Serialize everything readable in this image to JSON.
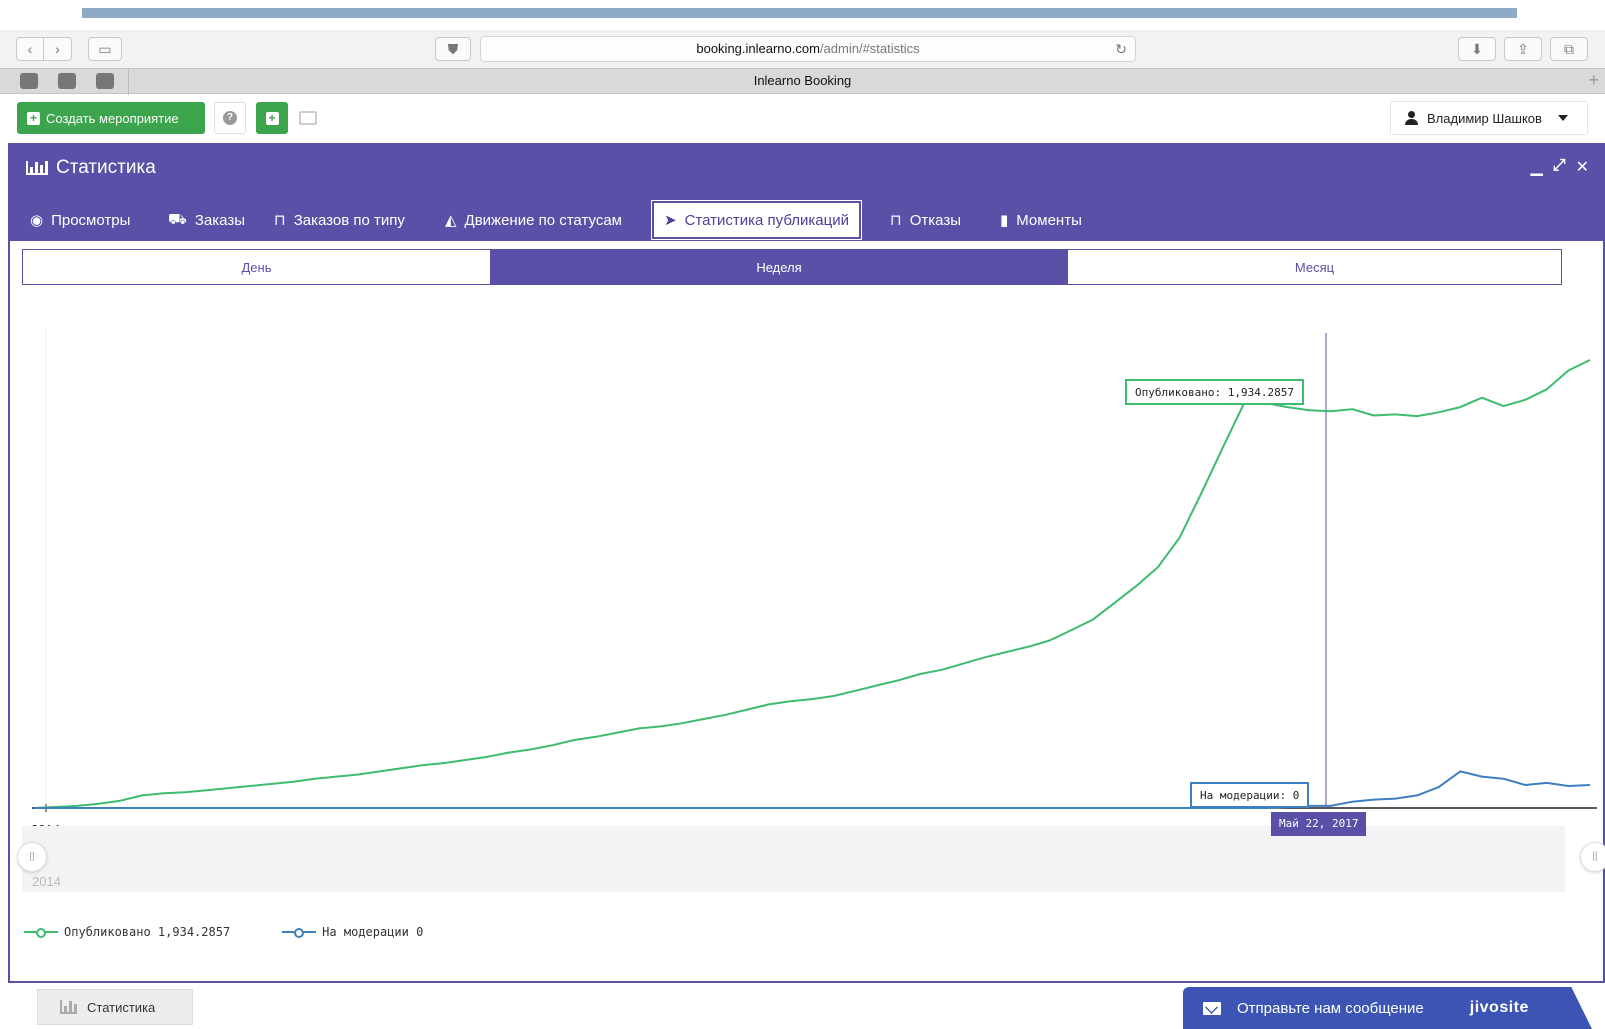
{
  "browser": {
    "url_host": "booking.inlearno.com",
    "url_path": "/admin/#statistics",
    "tab_title": "Inlearno Booking"
  },
  "header": {
    "create_button": "Создать мероприятие",
    "user_name": "Владимир Шашков"
  },
  "panel": {
    "title": "Статистика",
    "tabs": [
      {
        "label": "Просмотры",
        "icon": "eye-icon"
      },
      {
        "label": "Заказы",
        "icon": "truck-icon"
      },
      {
        "label": "Заказов по типу",
        "icon": "basket-icon"
      },
      {
        "label": "Движение по статусам",
        "icon": "area-chart-icon"
      },
      {
        "label": "Статистика публикаций",
        "icon": "paper-plane-icon",
        "active": true
      },
      {
        "label": "Отказы",
        "icon": "basket-icon"
      },
      {
        "label": "Моменты",
        "icon": "bookmark-icon"
      }
    ],
    "periods": [
      {
        "label": "День",
        "active": false
      },
      {
        "label": "Неделя",
        "active": true
      },
      {
        "label": "Месяц",
        "active": false
      }
    ]
  },
  "chart_data": {
    "type": "line",
    "x_start_label": "2014",
    "navigator_label": "2014",
    "crosshair_date": "Май 22, 2017",
    "series": [
      {
        "name": "Опубликовано",
        "color": "#3dbb6f",
        "values": [
          0,
          5,
          10,
          20,
          35,
          60,
          70,
          75,
          85,
          95,
          105,
          115,
          125,
          140,
          150,
          160,
          175,
          190,
          205,
          215,
          230,
          245,
          265,
          280,
          300,
          325,
          340,
          360,
          380,
          390,
          405,
          425,
          445,
          470,
          495,
          510,
          520,
          535,
          560,
          585,
          610,
          640,
          660,
          690,
          720,
          745,
          770,
          800,
          850,
          900,
          980,
          1060,
          1150,
          1290,
          1500,
          1720,
          1934.2857,
          1934.2857,
          1915,
          1900,
          1895,
          1905,
          1875,
          1880,
          1872,
          1890,
          1915,
          1960,
          1920,
          1950,
          2000,
          2090,
          2140
        ]
      },
      {
        "name": "На модерации",
        "color": "#3e7fbf",
        "values": [
          0,
          0,
          0,
          0,
          0,
          0,
          0,
          0,
          0,
          0,
          0,
          0,
          0,
          0,
          0,
          0,
          0,
          0,
          0,
          0,
          0,
          0,
          0,
          0,
          0,
          0,
          0,
          0,
          0,
          0,
          0,
          0,
          0,
          0,
          0,
          0,
          0,
          0,
          0,
          0,
          0,
          0,
          0,
          0,
          0,
          0,
          0,
          0,
          0,
          0,
          0,
          0,
          0,
          0,
          0,
          0,
          0,
          0,
          5,
          10,
          10,
          30,
          40,
          45,
          60,
          100,
          175,
          150,
          140,
          110,
          120,
          105,
          110
        ]
      }
    ],
    "tooltips": {
      "published": "Опубликовано: 1,934.2857",
      "moderation": "На модерации: 0"
    },
    "legend": [
      {
        "label": "Опубликовано 1,934.2857",
        "color": "#3dbb6f"
      },
      {
        "label": "На модерации 0",
        "color": "#3e7fbf"
      }
    ]
  },
  "footer": {
    "stat_tab": "Статистика",
    "chat_text": "Отправьте нам сообщение",
    "chat_brand": "jivosite"
  }
}
